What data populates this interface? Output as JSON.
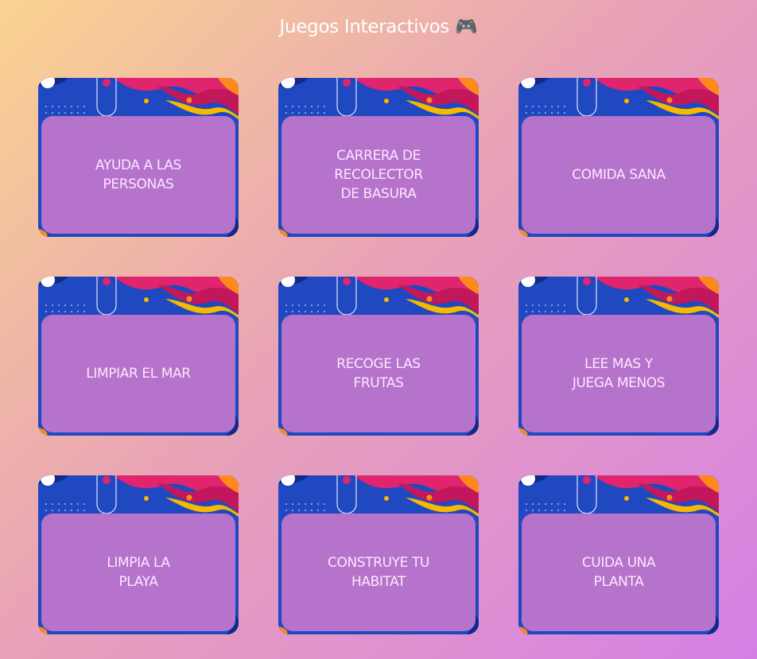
{
  "header": {
    "title": "Juegos Interactivos 🎮"
  },
  "games": [
    {
      "label": "AYUDA A LAS PERSONAS"
    },
    {
      "label": "CARRERA DE RECOLECTOR DE BASURA"
    },
    {
      "label": "COMIDA SANA"
    },
    {
      "label": "LIMPIAR EL MAR"
    },
    {
      "label": "RECOGE LAS FRUTAS"
    },
    {
      "label": "LEE MAS Y JUEGA MENOS"
    },
    {
      "label": "LIMPIA LA PLAYA"
    },
    {
      "label": "CONSTRUYE TU HABITAT"
    },
    {
      "label": "CUIDA UNA PLANTA"
    }
  ],
  "colors": {
    "card_blue": "#1d3db3",
    "card_panel": "#b573cb",
    "accent_pink": "#e0246e",
    "accent_yellow": "#f6b800",
    "accent_orange": "#ff8a1c"
  }
}
